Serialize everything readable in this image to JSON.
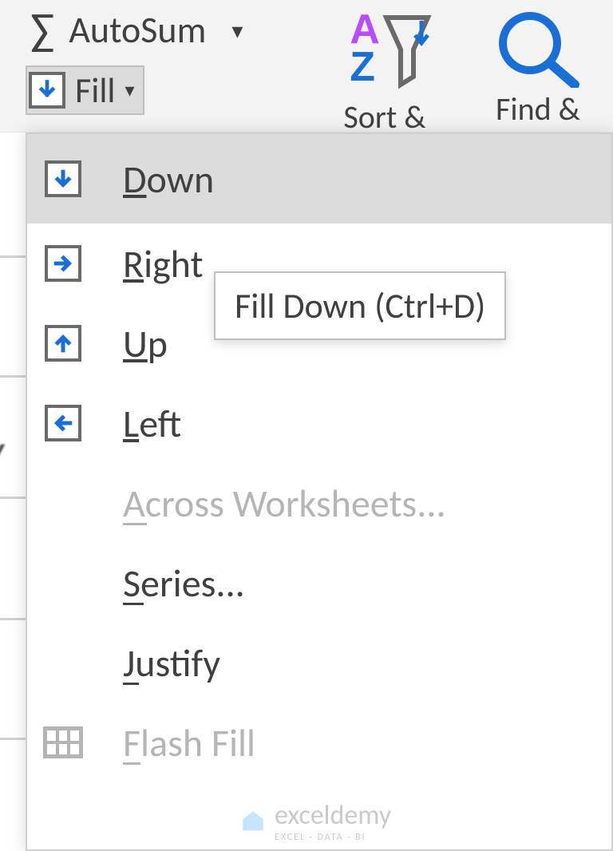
{
  "ribbon": {
    "autosum_label": "AutoSum",
    "fill_label": "Fill",
    "sort_label": "Sort &",
    "find_label": "Find &"
  },
  "menu": {
    "down": "Down",
    "right": "Right",
    "up": "Up",
    "left": "Left",
    "across": "Across Worksheets...",
    "series": "Series...",
    "justify": "Justify",
    "flash": "Flash Fill"
  },
  "tooltip": "Fill Down (Ctrl+D)",
  "watermark": {
    "main": "exceldemy",
    "sub": "EXCEL · DATA · BI"
  }
}
